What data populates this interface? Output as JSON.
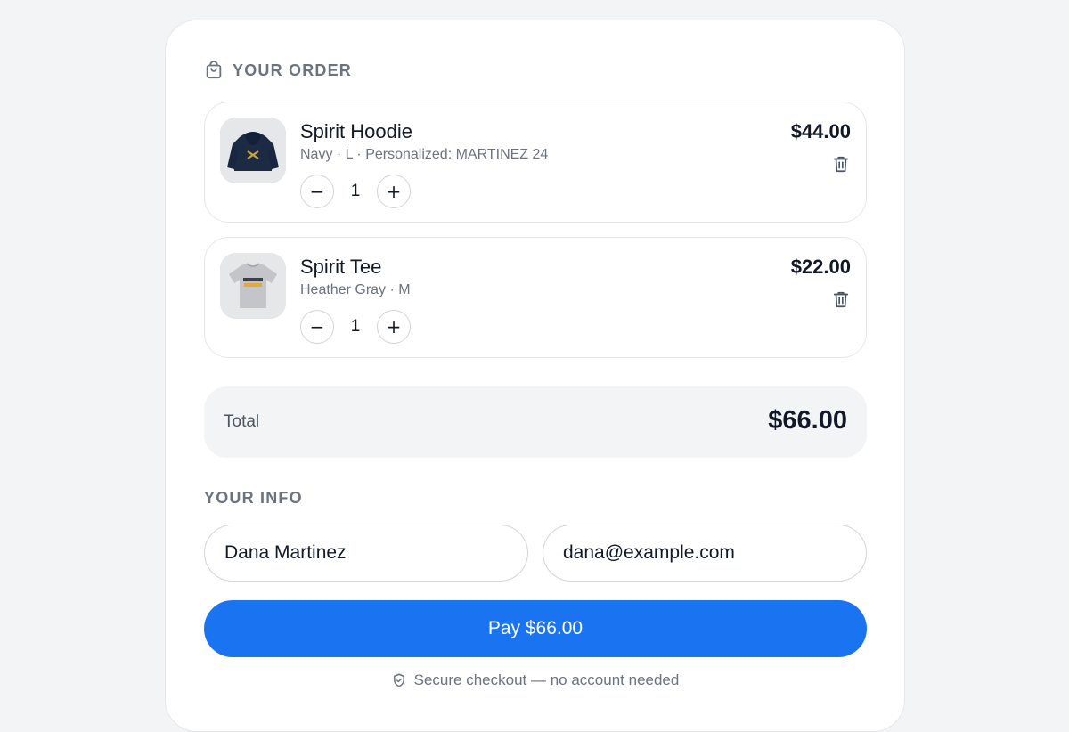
{
  "order": {
    "title": "YOUR ORDER",
    "icon": "shopping-bag-icon",
    "items": [
      {
        "name": "Spirit Hoodie",
        "meta": "Navy · L · Personalized: MARTINEZ 24",
        "price": "$44.00",
        "quantity": "1",
        "thumb_icon": "hoodie-image"
      },
      {
        "name": "Spirit Tee",
        "meta": "Heather Gray · M",
        "price": "$22.00",
        "quantity": "1",
        "thumb_icon": "tshirt-image"
      }
    ],
    "minus_symbol": "−",
    "plus_symbol": "+"
  },
  "total": {
    "label": "Total",
    "value": "$66.00"
  },
  "info": {
    "title": "YOUR INFO",
    "name_value": "Dana Martinez",
    "email_value": "dana@example.com"
  },
  "pay_button": {
    "label": "Pay $66.00",
    "color": "#1a73f0"
  },
  "footer": {
    "secure_text": "Secure checkout — no account needed",
    "icon": "shield-check-icon"
  }
}
